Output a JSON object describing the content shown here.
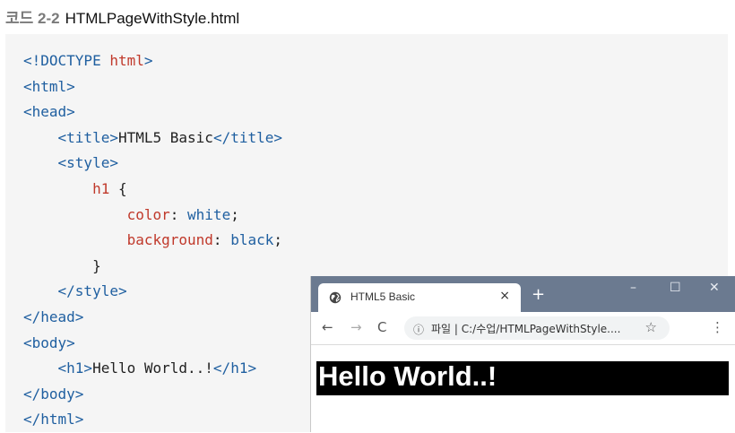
{
  "caption": {
    "label": "코드 2-2",
    "filename": "HTMLPageWithStyle.html"
  },
  "code_lines": [
    [
      {
        "t": "<!DOCTYPE ",
        "c": "tag"
      },
      {
        "t": "html",
        "c": "kw"
      },
      {
        "t": ">",
        "c": "tag"
      }
    ],
    [
      {
        "t": "<html>",
        "c": "tag"
      }
    ],
    [
      {
        "t": "<head>",
        "c": "tag"
      }
    ],
    [
      {
        "t": "    ",
        "c": "txt"
      },
      {
        "t": "<title>",
        "c": "tag"
      },
      {
        "t": "HTML5 Basic",
        "c": "txt"
      },
      {
        "t": "</title>",
        "c": "tag"
      }
    ],
    [
      {
        "t": "    ",
        "c": "txt"
      },
      {
        "t": "<style>",
        "c": "tag"
      }
    ],
    [
      {
        "t": "        ",
        "c": "txt"
      },
      {
        "t": "h1",
        "c": "kw"
      },
      {
        "t": " {",
        "c": "txt"
      }
    ],
    [
      {
        "t": "            ",
        "c": "txt"
      },
      {
        "t": "color",
        "c": "prop"
      },
      {
        "t": ": ",
        "c": "txt"
      },
      {
        "t": "white",
        "c": "val"
      },
      {
        "t": ";",
        "c": "txt"
      }
    ],
    [
      {
        "t": "            ",
        "c": "txt"
      },
      {
        "t": "background",
        "c": "prop"
      },
      {
        "t": ": ",
        "c": "txt"
      },
      {
        "t": "black",
        "c": "val"
      },
      {
        "t": ";",
        "c": "txt"
      }
    ],
    [
      {
        "t": "        }",
        "c": "txt"
      }
    ],
    [
      {
        "t": "    ",
        "c": "txt"
      },
      {
        "t": "</style>",
        "c": "tag"
      }
    ],
    [
      {
        "t": "</head>",
        "c": "tag"
      }
    ],
    [
      {
        "t": "<body>",
        "c": "tag"
      }
    ],
    [
      {
        "t": "    ",
        "c": "txt"
      },
      {
        "t": "<h1>",
        "c": "tag"
      },
      {
        "t": "Hello World..!",
        "c": "txt"
      },
      {
        "t": "</h1>",
        "c": "tag"
      }
    ],
    [
      {
        "t": "</body>",
        "c": "tag"
      }
    ],
    [
      {
        "t": "</html>",
        "c": "tag"
      }
    ]
  ],
  "browser": {
    "tab_title": "HTML5 Basic",
    "tab_close": "×",
    "new_tab": "+",
    "minimize": "–",
    "maximize": "☐",
    "close": "✕",
    "back": "←",
    "forward": "→",
    "reload": "C",
    "info": "ⓘ",
    "url": "파일 | C:/수업/HTMLPageWithStyle....",
    "star": "☆",
    "menu": "⋮",
    "page_heading": "Hello World..!"
  },
  "colors": {
    "titlebar": "#6b7a90",
    "tag": "#1f5fa0",
    "keyword": "#c0392b"
  }
}
